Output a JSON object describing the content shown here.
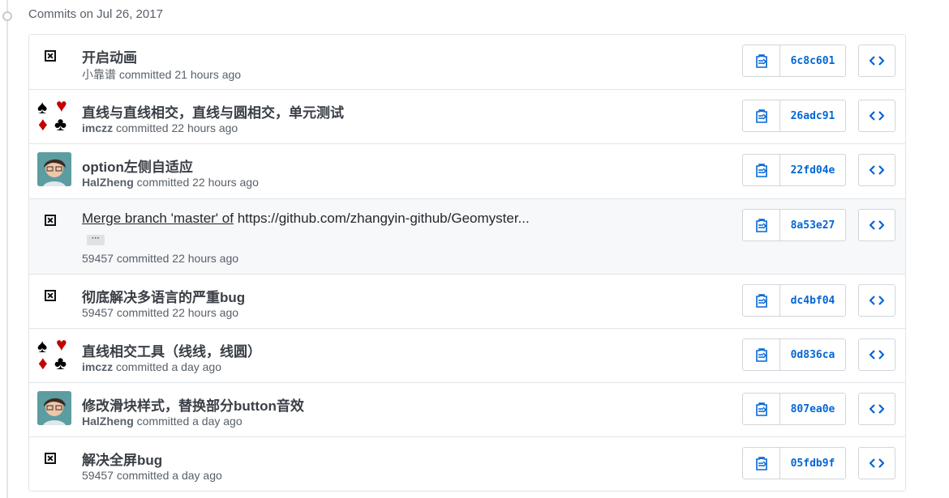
{
  "group": {
    "title": "Commits on Jul 26, 2017"
  },
  "commits": [
    {
      "title": "开启动画",
      "author": "小靠谱",
      "committed": "committed 21 hours ago",
      "sha": "6c8c601",
      "avatar": "broken-image"
    },
    {
      "title": "直线与直线相交，直线与圆相交，单元测试",
      "author": "imczz",
      "committed": "committed 22 hours ago",
      "sha": "26adc91",
      "avatar": "playing-card-suits"
    },
    {
      "title": "option左侧自适应",
      "author": "HalZheng",
      "committed": "committed 22 hours ago",
      "sha": "22fd04e",
      "avatar": "anime-person-photo"
    },
    {
      "title_part1": "Merge branch 'master' of",
      "title_part2": "https://github.com/zhangyin-github/Geomyster...",
      "expand": "···",
      "author": "59457",
      "committed": "committed 22 hours ago",
      "sha": "8a53e27",
      "avatar": "broken-image"
    },
    {
      "title": "彻底解决多语言的严重bug",
      "author": "59457",
      "committed": "committed 22 hours ago",
      "sha": "dc4bf04",
      "avatar": "broken-image"
    },
    {
      "title": "直线相交工具（线线，线圆）",
      "author": "imczz",
      "committed": "committed a day ago",
      "sha": "0d836ca",
      "avatar": "playing-card-suits"
    },
    {
      "title": "修改滑块样式，替换部分button音效",
      "author": "HalZheng",
      "committed": "committed a day ago",
      "sha": "807ea0e",
      "avatar": "anime-person-photo"
    },
    {
      "title": "解决全屏bug",
      "author": "59457",
      "committed": "committed a day ago",
      "sha": "05fdb9f",
      "avatar": "broken-image"
    }
  ],
  "icons": {
    "copy": "clipboard-icon",
    "browse": "code-brackets-icon"
  },
  "colors": {
    "link": "#0366d6",
    "border": "#e1e4e8",
    "highlight": "#f6f8fa"
  }
}
